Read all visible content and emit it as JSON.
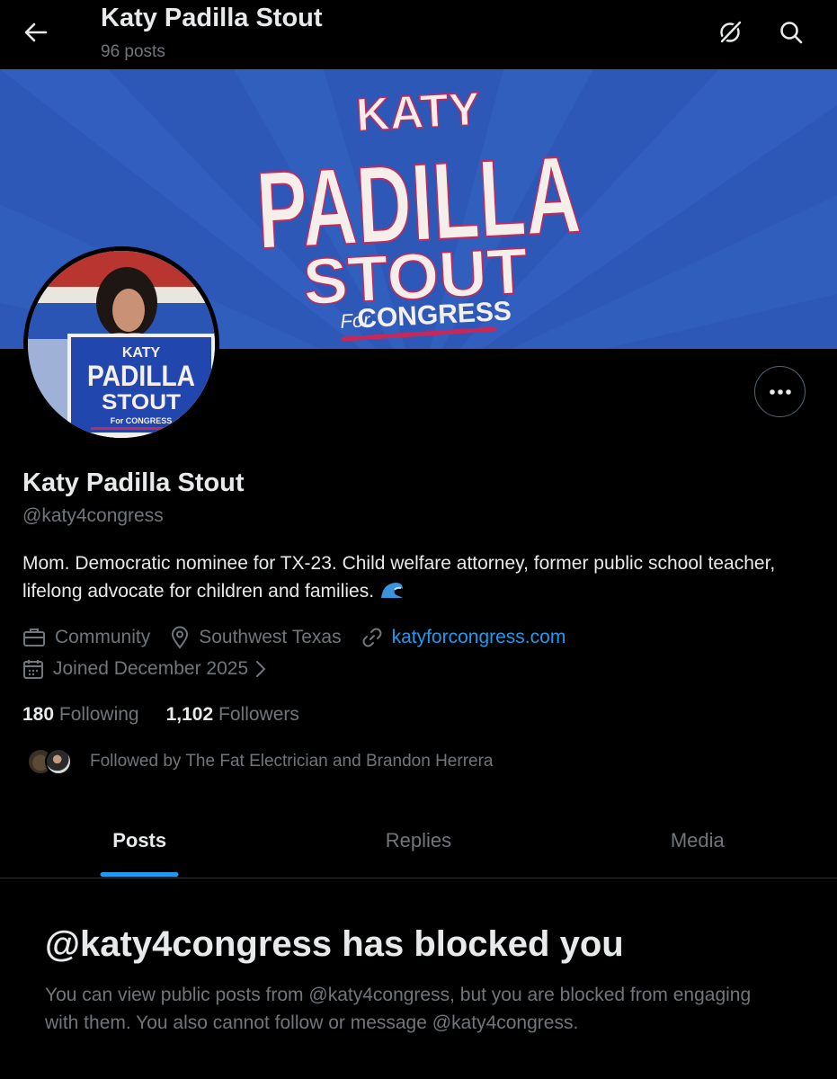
{
  "header": {
    "title": "Katy Padilla Stout",
    "post_count": "96 posts"
  },
  "banner": {
    "line1": "KATY",
    "line2": "PADILLA",
    "line3": "STOUT",
    "line4_for": "For",
    "line4": "CONGRESS"
  },
  "avatar_sign": {
    "line1": "KATY",
    "line2": "PADILLA",
    "line3": "STOUT",
    "line4": "For CONGRESS"
  },
  "profile": {
    "name": "Katy Padilla Stout",
    "handle": "@katy4congress",
    "bio": "Mom. Democratic nominee for TX-23. Child welfare attorney, former public school teacher, lifelong advocate for children and families.",
    "category": "Community",
    "location": "Southwest Texas",
    "website": "katyforcongress.com",
    "joined": "Joined December 2025"
  },
  "stats": {
    "following_count": "180",
    "following_label": "Following",
    "followers_count": "1,102",
    "followers_label": "Followers"
  },
  "followed_by": "Followed by The Fat Electrician and Brandon Herrera",
  "tabs": [
    {
      "label": "Posts",
      "active": true
    },
    {
      "label": "Replies",
      "active": false
    },
    {
      "label": "Media",
      "active": false
    }
  ],
  "blocked": {
    "title": "@katy4congress has blocked you",
    "message": "You can view public posts from @katy4congress, but you are blocked from engaging with them. You also cannot follow or message @katy4congress."
  },
  "colors": {
    "background": "#000000",
    "accent": "#1d9bf0",
    "banner_blue": "#2d58b8",
    "banner_stripe": "#c6285a",
    "muted_text": "#71767b"
  }
}
